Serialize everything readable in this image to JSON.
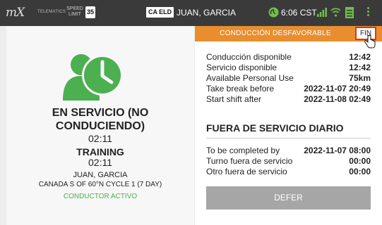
{
  "status_bar": {
    "logo": "mX",
    "telematics": "TELEMATICS",
    "speed_limit_label": "SPEED LIMIT",
    "speed_limit_value": "35",
    "eld_badge": "CA ELD",
    "driver_name": "JUAN, GARCIA",
    "time": "6:06 CST",
    "accent_color": "#6ec04a"
  },
  "left_panel": {
    "status_title": "EN SERVICIO (NO CONDUCIENDO)",
    "status_timer": "02:11",
    "training_label": "TRAINING",
    "training_timer": "02:11",
    "driver_name": "JUAN, GARCIA",
    "cycle": "CANADA S OF 60°N CYCLE 1 (7 DAY)",
    "conductor_status": "CONDUCTOR ACTIVO",
    "icon_color": "#4caf50"
  },
  "right_panel": {
    "alert_text": "CONDUCCIÓN DESFAVORABLE",
    "alert_color": "#e88e2e",
    "fin_label": "FIN",
    "availability": [
      {
        "label": "Conducción disponible",
        "value": "12:42"
      },
      {
        "label": "Servicio disponible",
        "value": "12:42"
      },
      {
        "label": "Available Personal Use",
        "value": "75km"
      },
      {
        "label": "Take break before",
        "value": "2022-11-07 20:49"
      },
      {
        "label": "Start shift after",
        "value": "2022-11-08 02:49"
      }
    ],
    "daily_off_title": "FUERA DE SERVICIO DIARIO",
    "daily_off": [
      {
        "label": "To be completed by",
        "value": "2022-11-07 08:00"
      },
      {
        "label": "Turno fuera de servicio",
        "value": "00:00"
      },
      {
        "label": "Otro fuera de servicio",
        "value": "00:00"
      }
    ],
    "defer_label": "DEFER"
  }
}
